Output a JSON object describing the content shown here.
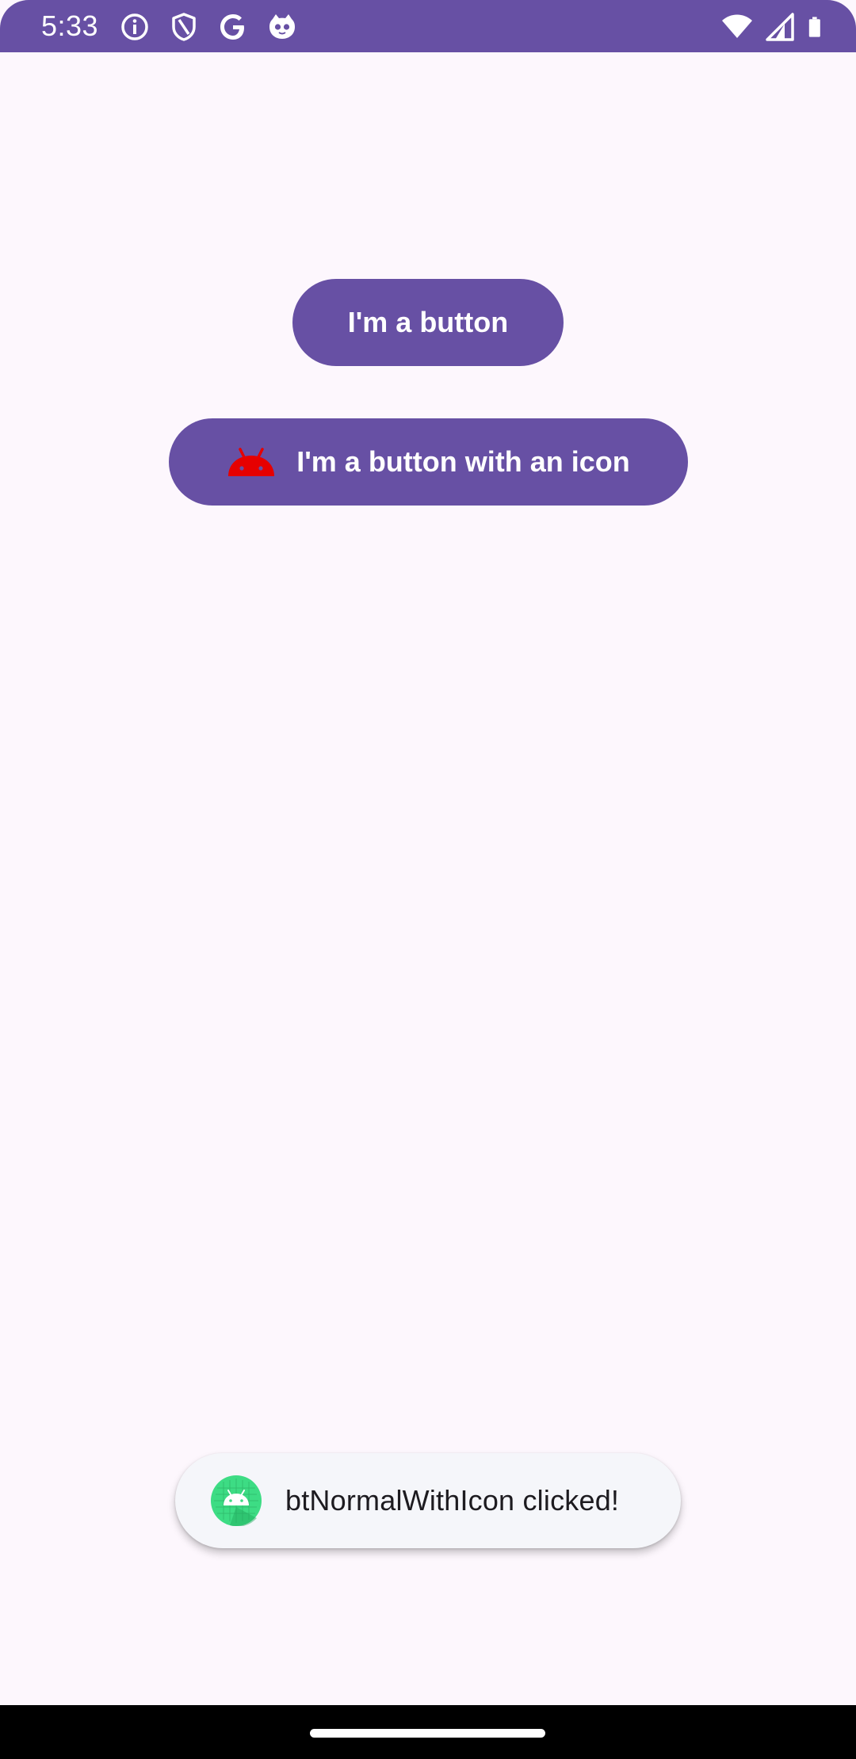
{
  "status_bar": {
    "time": "5:33",
    "left_icons": [
      "info-icon",
      "shield-icon",
      "google-icon",
      "cat-face-icon"
    ],
    "right_icons": [
      "wifi-icon",
      "signal-icon",
      "battery-icon"
    ],
    "color": "#6750a4"
  },
  "buttons": {
    "normal_label": "I'm a button",
    "icon_label": "I'm a button with an icon",
    "icon_name": "android-head-icon",
    "icon_color": "#e60000",
    "background": "#6750a4"
  },
  "toast": {
    "message": "btNormalWithIcon clicked!",
    "icon_name": "android-app-icon",
    "icon_color": "#3ddc84"
  },
  "background_color": "#fdf7fd"
}
